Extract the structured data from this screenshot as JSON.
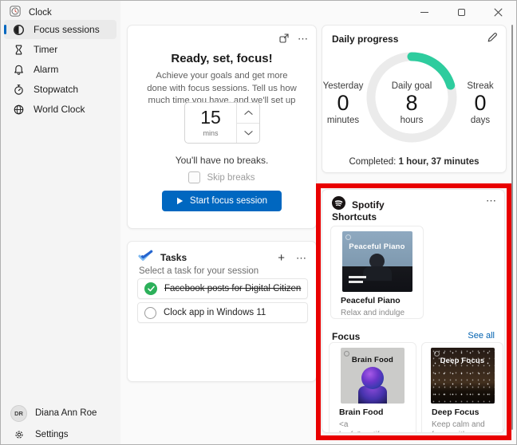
{
  "colors": {
    "accent": "#0067c0",
    "progress_green": "#2ecc9e",
    "task_done_green": "#2cb05a",
    "annotation_red": "#e90000",
    "link_blue": "#0061b0"
  },
  "icons": {
    "ellipsis": "⋯",
    "plus": "+"
  },
  "titlebar": {
    "app_name": "Clock"
  },
  "sidebar": {
    "items": [
      {
        "label": "Focus sessions",
        "selected": true
      },
      {
        "label": "Timer",
        "selected": false
      },
      {
        "label": "Alarm",
        "selected": false
      },
      {
        "label": "Stopwatch",
        "selected": false
      },
      {
        "label": "World Clock",
        "selected": false
      }
    ],
    "user": {
      "initials": "DR",
      "name": "Diana Ann Roe"
    },
    "settings_label": "Settings"
  },
  "focus_setup": {
    "title": "Ready, set, focus!",
    "description": "Achieve your goals and get more done with focus sessions. Tell us how much time you have, and we'll set up the rest.",
    "duration_value": "15",
    "duration_unit": "mins",
    "breaks_note": "You'll have no breaks.",
    "skip_breaks_label": "Skip breaks",
    "start_button": "Start focus session"
  },
  "tasks": {
    "title": "Tasks",
    "subtitle": "Select a task for your session",
    "items": [
      {
        "label": "Facebook posts for Digital Citizen",
        "done": true
      },
      {
        "label": "Clock app in Windows 11",
        "done": false
      }
    ]
  },
  "daily_progress": {
    "title": "Daily progress",
    "yesterday": {
      "label": "Yesterday",
      "value": "0",
      "unit": "minutes"
    },
    "goal": {
      "label": "Daily goal",
      "value": "8",
      "unit": "hours"
    },
    "streak": {
      "label": "Streak",
      "value": "0",
      "unit": "days"
    },
    "completed_label": "Completed: ",
    "completed_value": "1 hour, 37 minutes",
    "percent": 20.2
  },
  "spotify": {
    "brand": "Spotify",
    "shortcuts_title": "Shortcuts",
    "focus_title": "Focus",
    "see_all": "See all",
    "shortcuts": [
      {
        "title": "Peaceful Piano",
        "art_text": "Peaceful Piano",
        "description": "Relax and indulge with beautiful piano..."
      }
    ],
    "focus_items": [
      {
        "title": "Brain Food",
        "art_text": "Brain Food",
        "description": "<a href=\"spotify:genre:..."
      },
      {
        "title": "Deep Focus",
        "art_text": "Deep Focus",
        "description": "Keep calm and focus with ambient and..."
      }
    ]
  }
}
